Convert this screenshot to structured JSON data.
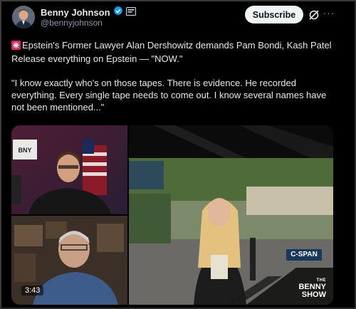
{
  "author": {
    "name": "Benny Johnson",
    "handle": "@bennyjohnson"
  },
  "header": {
    "subscribe_label": "Subscribe",
    "more_label": "···"
  },
  "tweet": {
    "paragraph1": "Epstein's Former Lawyer Alan Dershowitz demands Pam Bondi, Kash Patel Release everything on Epstein — \"NOW.\"",
    "paragraph2": "\"I know exactly who's on those tapes. There is evidence. He recorded everything. Every single tape needs to come out. I know several names have not been mentioned...\""
  },
  "media": {
    "duration": "3:43",
    "network_bug": "C-SPAN",
    "show_logo_top": "THE",
    "show_logo_main": "BENNY SHOW"
  },
  "colors": {
    "background": "#000000",
    "accent": "#1d9bf0",
    "subscribe_bg": "#eff3f4"
  }
}
